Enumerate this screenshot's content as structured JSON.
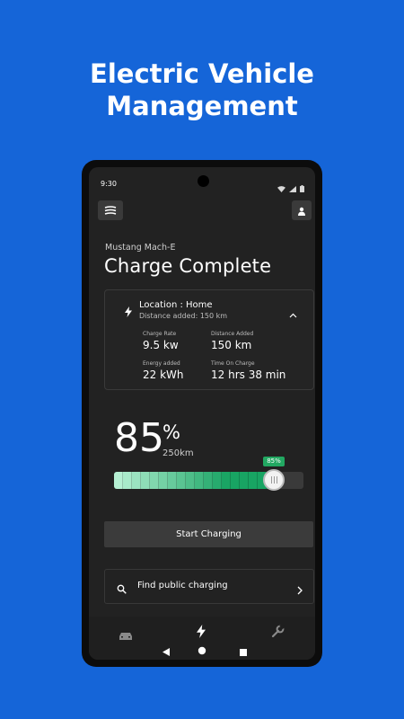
{
  "headline": {
    "line1": "Electric Vehicle",
    "line2": "Management"
  },
  "status_bar": {
    "time": "9:30"
  },
  "vehicle": {
    "name": "Mustang Mach-E"
  },
  "page_title": "Charge Complete",
  "charge_card": {
    "location": "Location : Home",
    "distance_added_line": "Distance added: 150  km",
    "stats": {
      "charge_rate_label": "Charge Rate",
      "charge_rate_value": "9.5 kw",
      "distance_added_label": "Distance Added",
      "distance_added_value": "150 km",
      "energy_added_label": "Energy added",
      "energy_added_value": "22 kWh",
      "time_on_charge_label": "Time On Charge",
      "time_on_charge_value": "12 hrs 38 min"
    }
  },
  "battery": {
    "percent_value": "85",
    "percent_symbol": "%",
    "range": "250km",
    "badge": "85%",
    "level": 0.85
  },
  "actions": {
    "start_charging": "Start Charging",
    "find_public_charging": "Find public charging"
  },
  "icons": {
    "menu": "menu-icon",
    "profile": "person-icon",
    "bolt": "bolt-icon",
    "chevron_up": "chevron-up-icon",
    "search": "search-icon",
    "chevron_right": "chevron-right-icon",
    "nav_car": "car-icon",
    "nav_charge": "bolt-icon",
    "nav_service": "wrench-icon"
  },
  "colors": {
    "background": "#1565d8",
    "screen": "#222222",
    "accent_green": "#22a862",
    "bar_start": "#b5f0d3",
    "bar_end": "#18a463"
  }
}
